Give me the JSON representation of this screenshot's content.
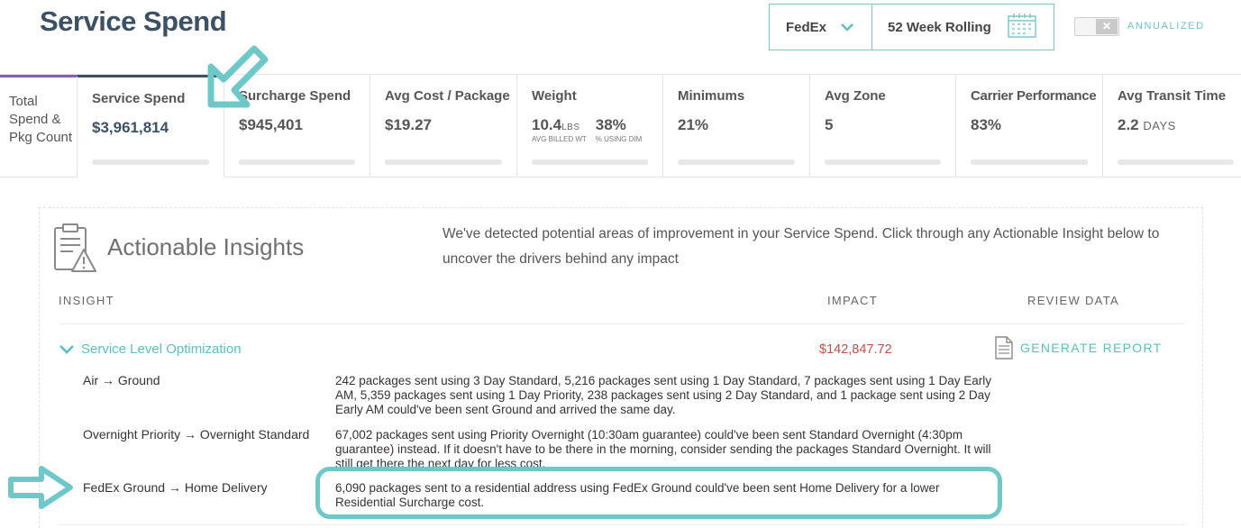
{
  "page": {
    "title": "Service Spend"
  },
  "filters": {
    "carrier": "FedEx",
    "period": "52 Week Rolling",
    "annualized_label": "ANNUALIZED"
  },
  "tabs": {
    "first": {
      "label": "Total Spend & Pkg Count"
    },
    "service": {
      "label": "Service Spend",
      "value": "$3,961,814"
    },
    "surcharge": {
      "label": "Surcharge Spend",
      "value": "$945,401"
    },
    "avg_cost": {
      "label": "Avg Cost / Package",
      "value": "$19.27"
    },
    "weight": {
      "label": "Weight",
      "value": "10.4",
      "unit": "LBS",
      "sub1": "AVG BILLED WT",
      "pct": "38%",
      "sub2": "% USING DIM"
    },
    "minimums": {
      "label": "Minimums",
      "value": "21%"
    },
    "avg_zone": {
      "label": "Avg Zone",
      "value": "5"
    },
    "carrier_perf": {
      "label": "Carrier Performance",
      "value": "83%"
    },
    "transit": {
      "label": "Avg Transit Time",
      "value": "2.2",
      "unit": "DAYS"
    }
  },
  "insights": {
    "title": "Actionable Insights",
    "description": "We've detected potential areas of improvement in your Service Spend. Click through any Actionable Insight below to uncover the drivers behind any impact",
    "columns": {
      "insight": "INSIGHT",
      "impact": "IMPACT",
      "review": "REVIEW DATA"
    },
    "section": {
      "title": "Service Level Optimization",
      "impact": "$142,847.72",
      "action": "GENERATE REPORT"
    },
    "rows": [
      {
        "label": "Air → Ground",
        "text": "242 packages sent using 3 Day Standard, 5,216 packages sent using 1 Day Standard, 7 packages sent using 1 Day Early AM, 5,359 packages sent using 1 Day Priority, 238 packages sent using 2 Day Standard, and 1 package sent using 2 Day Early AM could've been sent Ground and arrived the same day."
      },
      {
        "label": "Overnight Priority → Overnight Standard",
        "text": "67,002 packages sent using Priority Overnight (10:30am guarantee) could've been sent Standard Overnight (4:30pm guarantee) instead. If it doesn't have to be there in the morning, consider sending the packages Standard Overnight. It will still get there the next day for less cost."
      },
      {
        "label": "FedEx Ground → Home Delivery",
        "text": "6,090 packages sent to a residential address using FedEx Ground could've been sent Home Delivery for a lower Residential Surcharge cost."
      }
    ]
  },
  "colors": {
    "accent": "#5bbfbf",
    "title": "#3d5166",
    "impact": "#c0504d",
    "tab_first_border": "#8b5bb8",
    "annotation": "#6ec8c8"
  }
}
